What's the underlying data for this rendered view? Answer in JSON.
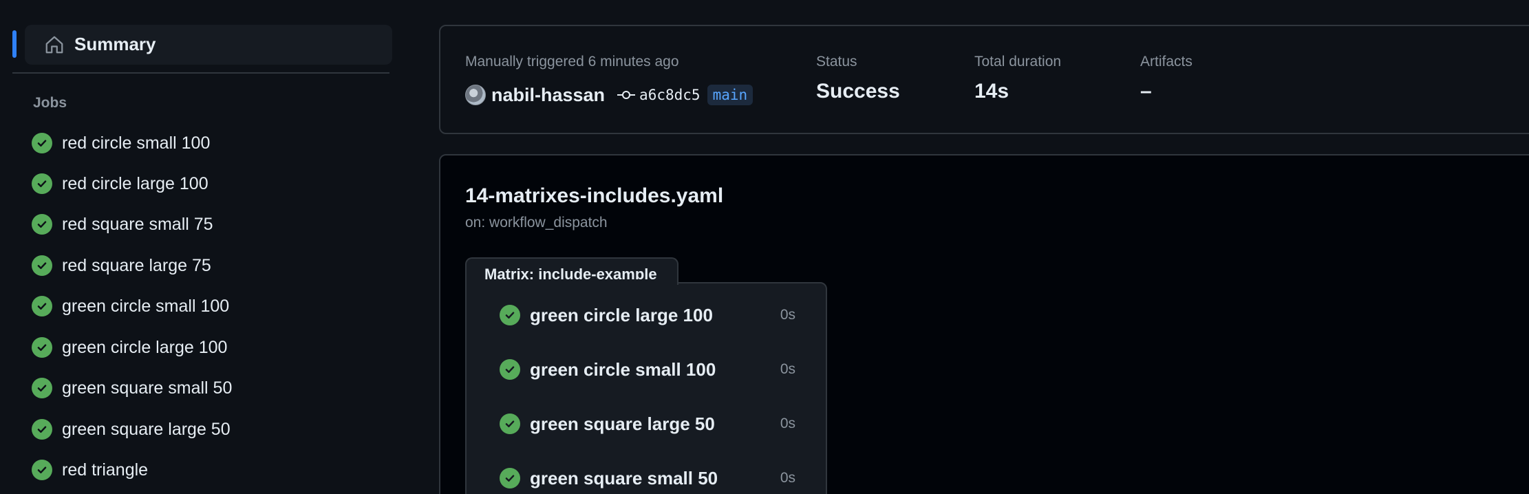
{
  "sidebar": {
    "summary_label": "Summary",
    "jobs_heading": "Jobs",
    "jobs": [
      {
        "label": "red circle small 100"
      },
      {
        "label": "red circle large 100"
      },
      {
        "label": "red square small 75"
      },
      {
        "label": "red square large 75"
      },
      {
        "label": "green circle small 100"
      },
      {
        "label": "green circle large 100"
      },
      {
        "label": "green square small 50"
      },
      {
        "label": "green square large 50"
      },
      {
        "label": "red triangle"
      }
    ]
  },
  "run": {
    "trigger": "Manually triggered 6 minutes ago",
    "actor": "nabil-hassan",
    "commit": "a6c8dc5",
    "branch": "main",
    "status_label": "Status",
    "status_value": "Success",
    "duration_label": "Total duration",
    "duration_value": "14s",
    "artifacts_label": "Artifacts",
    "artifacts_value": "–"
  },
  "workflow": {
    "title": "14-matrixes-includes.yaml",
    "trigger": "on: workflow_dispatch",
    "matrix_label": "Matrix: include-example",
    "matrix_jobs": [
      {
        "label": "green circle large 100",
        "duration": "0s"
      },
      {
        "label": "green circle small 100",
        "duration": "0s"
      },
      {
        "label": "green square large 50",
        "duration": "0s"
      },
      {
        "label": "green square small 50",
        "duration": "0s"
      }
    ]
  },
  "colors": {
    "background": "#0d1117",
    "success": "#57ab5a",
    "accent": "#2f81f7",
    "branch": "#58a6ff"
  }
}
